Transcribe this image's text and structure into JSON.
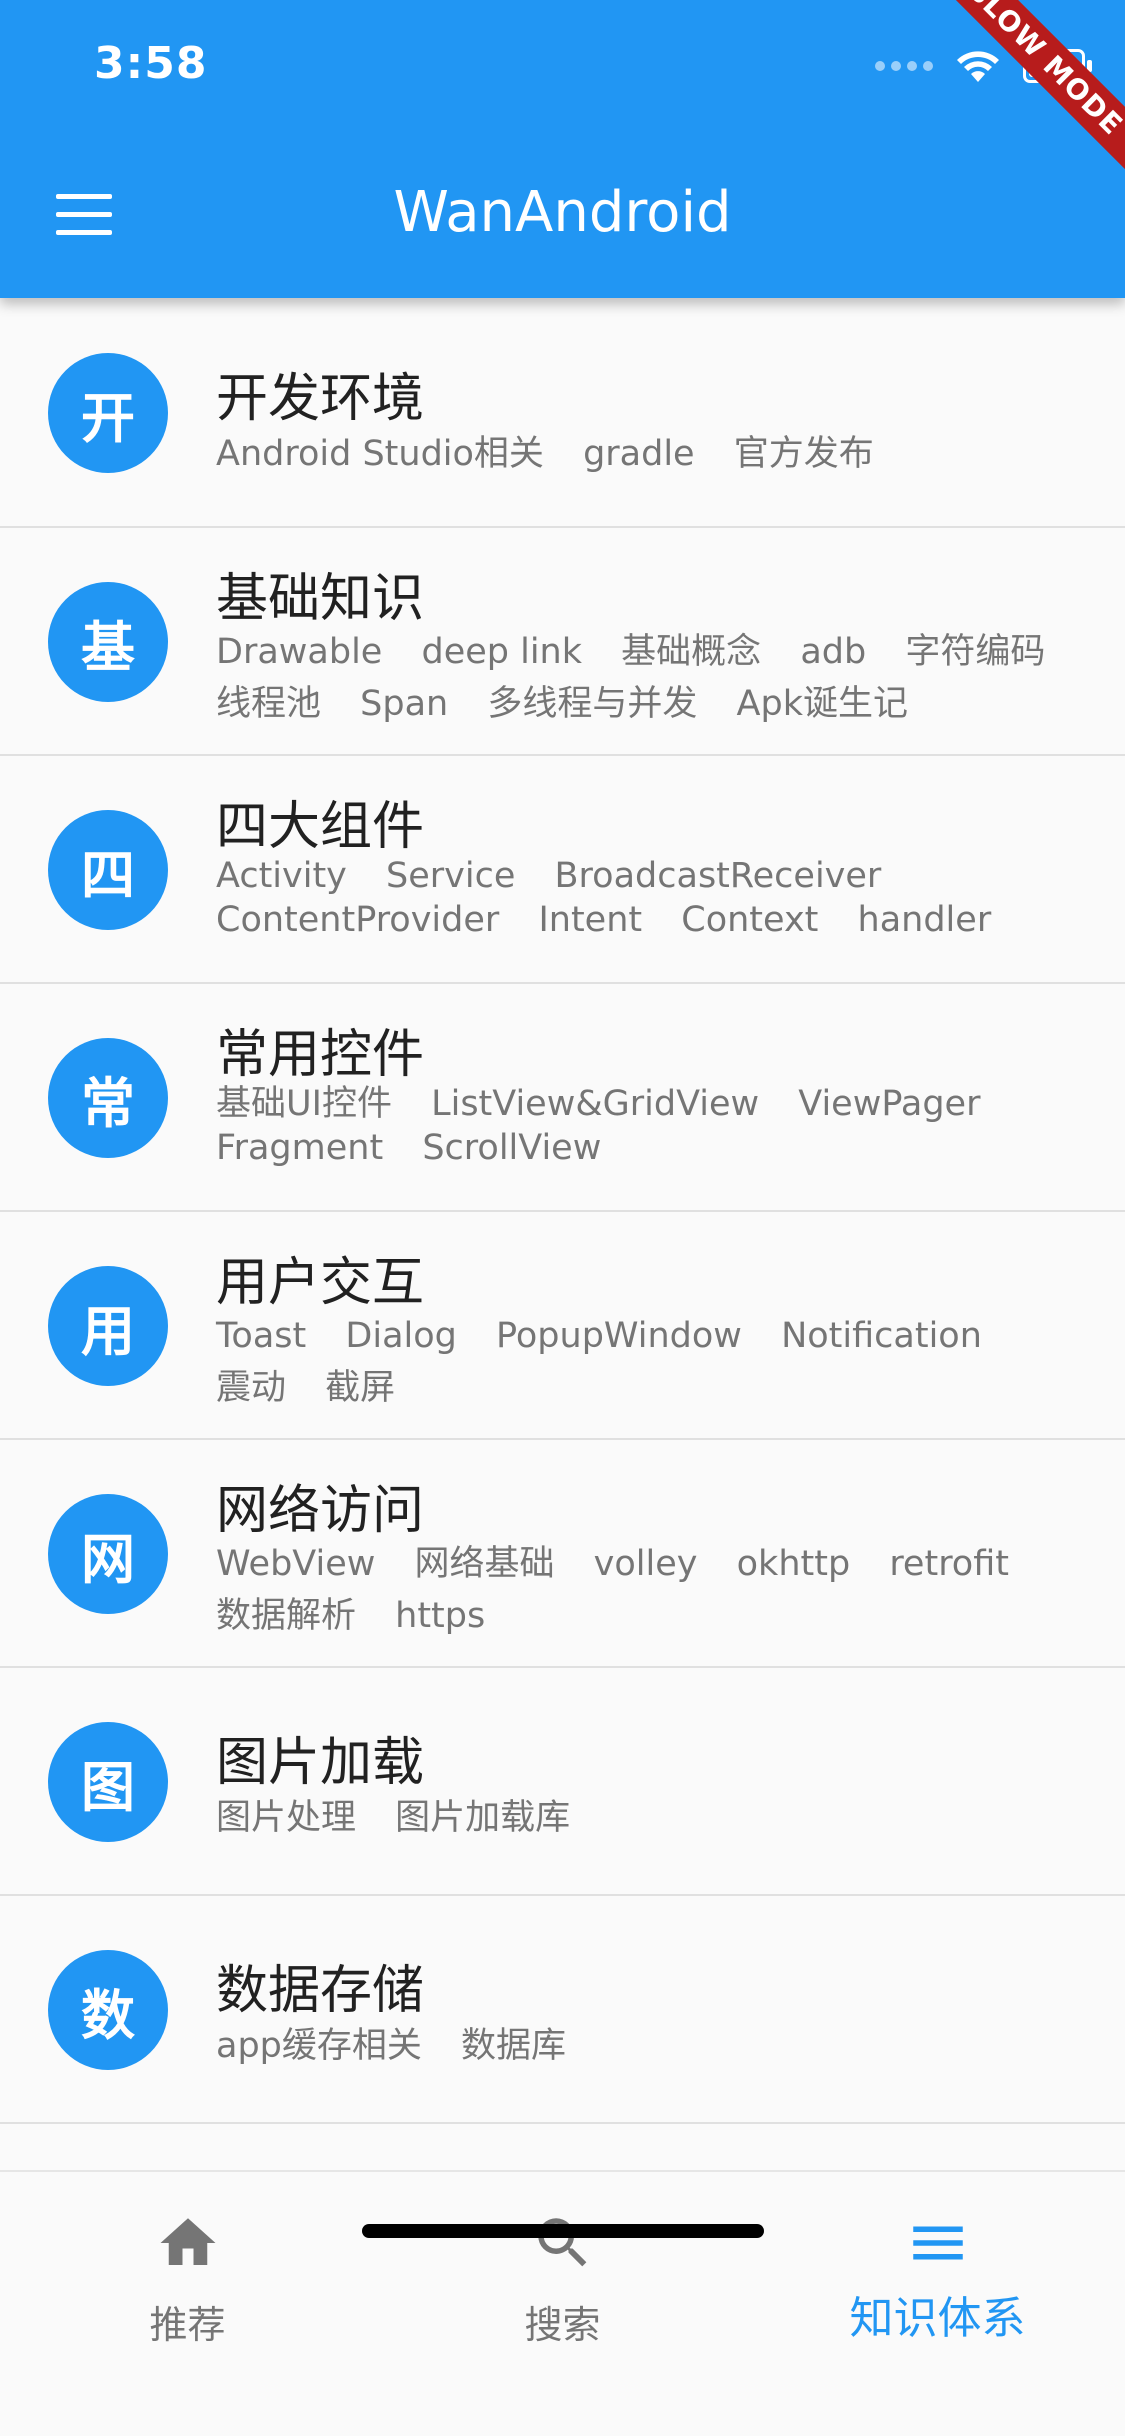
{
  "status": {
    "time": "3:58",
    "battery_level": 0.85
  },
  "appbar": {
    "title": "WanAndroid",
    "debug_banner": "SLOW MODE"
  },
  "topics": [
    {
      "avatar": "开",
      "title": "开发环境",
      "tags": [
        "Android Studio相关",
        "gradle",
        "官方发布"
      ]
    },
    {
      "avatar": "基",
      "title": "基础知识",
      "tags": [
        "Drawable",
        "deep link",
        "基础概念",
        "adb",
        "字符编码",
        "线程池",
        "Span",
        "多线程与并发",
        "Apk诞生记"
      ]
    },
    {
      "avatar": "四",
      "title": "四大组件",
      "tags": [
        "Activity",
        "Service",
        "BroadcastReceiver",
        "ContentProvider",
        "Intent",
        "Context",
        "handler"
      ]
    },
    {
      "avatar": "常",
      "title": "常用控件",
      "tags": [
        "基础UI控件",
        "ListView&GridView",
        "ViewPager",
        "Fragment",
        "ScrollView"
      ]
    },
    {
      "avatar": "用",
      "title": "用户交互",
      "tags": [
        "Toast",
        "Dialog",
        "PopupWindow",
        "Notification",
        "震动",
        "截屏"
      ]
    },
    {
      "avatar": "网",
      "title": "网络访问",
      "tags": [
        "WebView",
        "网络基础",
        "volley",
        "okhttp",
        "retrofit",
        "数据解析",
        "https"
      ]
    },
    {
      "avatar": "图",
      "title": "图片加载",
      "tags": [
        "图片处理",
        "图片加载库"
      ]
    },
    {
      "avatar": "数",
      "title": "数据存储",
      "tags": [
        "app缓存相关",
        "数据库"
      ]
    }
  ],
  "bottom_nav": [
    {
      "label": "推荐",
      "icon": "home-icon"
    },
    {
      "label": "搜索",
      "icon": "search-icon"
    },
    {
      "label": "知识体系",
      "icon": "list-icon",
      "active": true
    }
  ],
  "colors": {
    "primary": "#2196f3",
    "inactive": "#757575"
  }
}
